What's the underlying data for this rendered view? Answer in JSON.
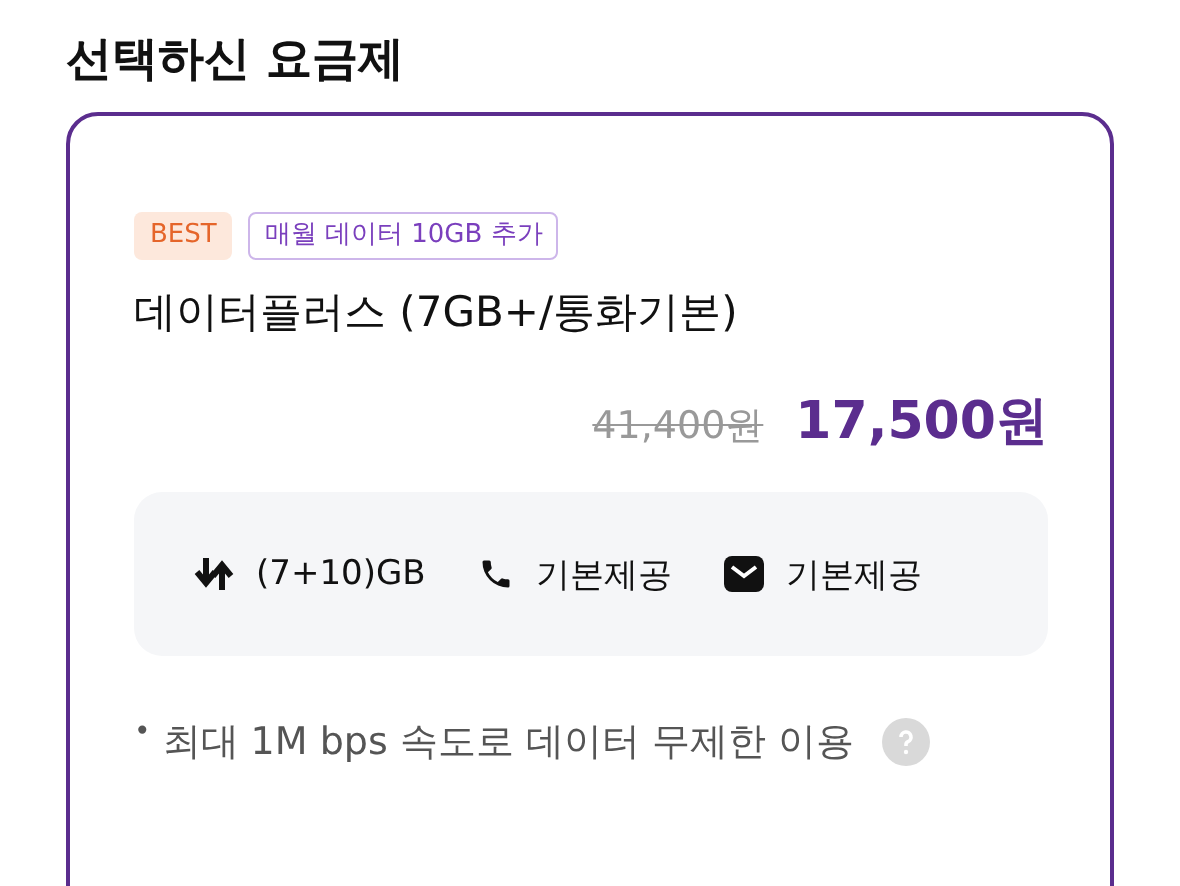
{
  "heading": "선택하신 요금제",
  "plan": {
    "badges": [
      {
        "kind": "best",
        "label": "BEST"
      },
      {
        "kind": "promo",
        "label": "매월 데이터 10GB 추가"
      }
    ],
    "name": "데이터플러스 (7GB+/통화기본)",
    "original_price": "41,400원",
    "price": "17,500원",
    "features": [
      {
        "kind": "data",
        "label": "(7+10)GB"
      },
      {
        "kind": "call",
        "label": "기본제공"
      },
      {
        "kind": "message",
        "label": "기본제공"
      }
    ],
    "note": {
      "bullet": "•",
      "text": "최대 1M bps 속도로 데이터 무제한 이용"
    }
  }
}
